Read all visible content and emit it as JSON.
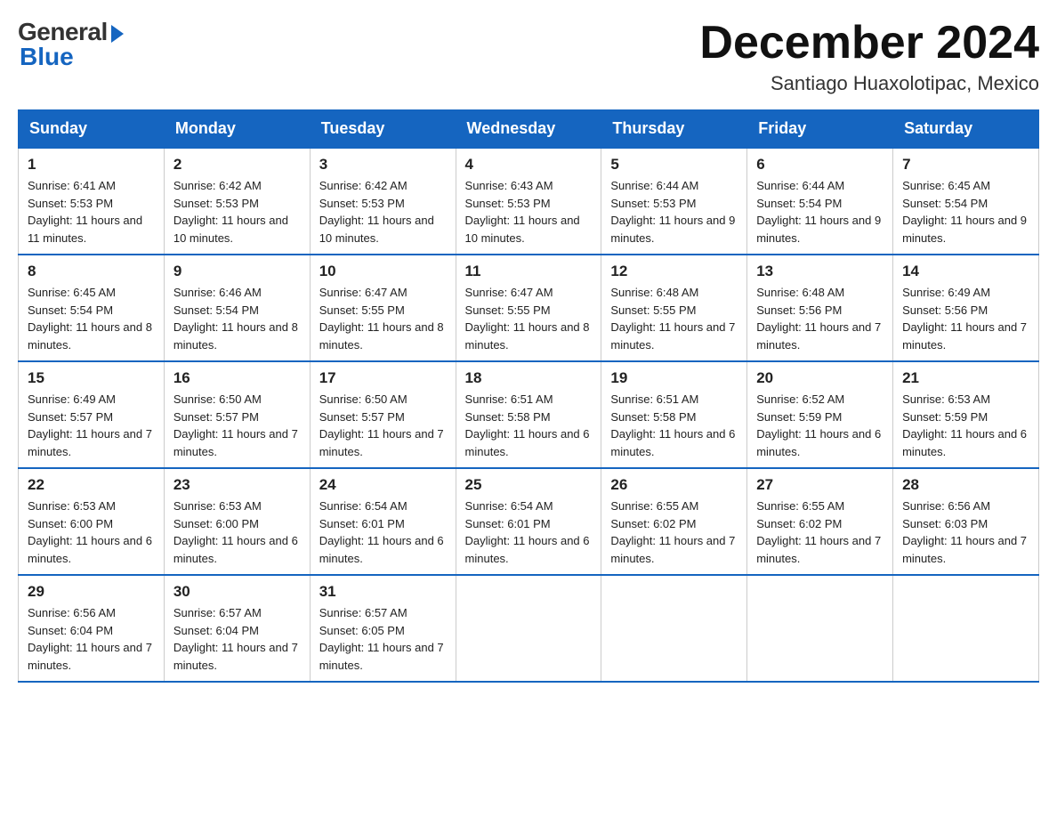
{
  "logo": {
    "general": "General",
    "blue": "Blue"
  },
  "header": {
    "month": "December 2024",
    "location": "Santiago Huaxolotipac, Mexico"
  },
  "days_of_week": [
    "Sunday",
    "Monday",
    "Tuesday",
    "Wednesday",
    "Thursday",
    "Friday",
    "Saturday"
  ],
  "weeks": [
    [
      {
        "day": "1",
        "sunrise": "6:41 AM",
        "sunset": "5:53 PM",
        "daylight": "11 hours and 11 minutes."
      },
      {
        "day": "2",
        "sunrise": "6:42 AM",
        "sunset": "5:53 PM",
        "daylight": "11 hours and 10 minutes."
      },
      {
        "day": "3",
        "sunrise": "6:42 AM",
        "sunset": "5:53 PM",
        "daylight": "11 hours and 10 minutes."
      },
      {
        "day": "4",
        "sunrise": "6:43 AM",
        "sunset": "5:53 PM",
        "daylight": "11 hours and 10 minutes."
      },
      {
        "day": "5",
        "sunrise": "6:44 AM",
        "sunset": "5:53 PM",
        "daylight": "11 hours and 9 minutes."
      },
      {
        "day": "6",
        "sunrise": "6:44 AM",
        "sunset": "5:54 PM",
        "daylight": "11 hours and 9 minutes."
      },
      {
        "day": "7",
        "sunrise": "6:45 AM",
        "sunset": "5:54 PM",
        "daylight": "11 hours and 9 minutes."
      }
    ],
    [
      {
        "day": "8",
        "sunrise": "6:45 AM",
        "sunset": "5:54 PM",
        "daylight": "11 hours and 8 minutes."
      },
      {
        "day": "9",
        "sunrise": "6:46 AM",
        "sunset": "5:54 PM",
        "daylight": "11 hours and 8 minutes."
      },
      {
        "day": "10",
        "sunrise": "6:47 AM",
        "sunset": "5:55 PM",
        "daylight": "11 hours and 8 minutes."
      },
      {
        "day": "11",
        "sunrise": "6:47 AM",
        "sunset": "5:55 PM",
        "daylight": "11 hours and 8 minutes."
      },
      {
        "day": "12",
        "sunrise": "6:48 AM",
        "sunset": "5:55 PM",
        "daylight": "11 hours and 7 minutes."
      },
      {
        "day": "13",
        "sunrise": "6:48 AM",
        "sunset": "5:56 PM",
        "daylight": "11 hours and 7 minutes."
      },
      {
        "day": "14",
        "sunrise": "6:49 AM",
        "sunset": "5:56 PM",
        "daylight": "11 hours and 7 minutes."
      }
    ],
    [
      {
        "day": "15",
        "sunrise": "6:49 AM",
        "sunset": "5:57 PM",
        "daylight": "11 hours and 7 minutes."
      },
      {
        "day": "16",
        "sunrise": "6:50 AM",
        "sunset": "5:57 PM",
        "daylight": "11 hours and 7 minutes."
      },
      {
        "day": "17",
        "sunrise": "6:50 AM",
        "sunset": "5:57 PM",
        "daylight": "11 hours and 7 minutes."
      },
      {
        "day": "18",
        "sunrise": "6:51 AM",
        "sunset": "5:58 PM",
        "daylight": "11 hours and 6 minutes."
      },
      {
        "day": "19",
        "sunrise": "6:51 AM",
        "sunset": "5:58 PM",
        "daylight": "11 hours and 6 minutes."
      },
      {
        "day": "20",
        "sunrise": "6:52 AM",
        "sunset": "5:59 PM",
        "daylight": "11 hours and 6 minutes."
      },
      {
        "day": "21",
        "sunrise": "6:53 AM",
        "sunset": "5:59 PM",
        "daylight": "11 hours and 6 minutes."
      }
    ],
    [
      {
        "day": "22",
        "sunrise": "6:53 AM",
        "sunset": "6:00 PM",
        "daylight": "11 hours and 6 minutes."
      },
      {
        "day": "23",
        "sunrise": "6:53 AM",
        "sunset": "6:00 PM",
        "daylight": "11 hours and 6 minutes."
      },
      {
        "day": "24",
        "sunrise": "6:54 AM",
        "sunset": "6:01 PM",
        "daylight": "11 hours and 6 minutes."
      },
      {
        "day": "25",
        "sunrise": "6:54 AM",
        "sunset": "6:01 PM",
        "daylight": "11 hours and 6 minutes."
      },
      {
        "day": "26",
        "sunrise": "6:55 AM",
        "sunset": "6:02 PM",
        "daylight": "11 hours and 7 minutes."
      },
      {
        "day": "27",
        "sunrise": "6:55 AM",
        "sunset": "6:02 PM",
        "daylight": "11 hours and 7 minutes."
      },
      {
        "day": "28",
        "sunrise": "6:56 AM",
        "sunset": "6:03 PM",
        "daylight": "11 hours and 7 minutes."
      }
    ],
    [
      {
        "day": "29",
        "sunrise": "6:56 AM",
        "sunset": "6:04 PM",
        "daylight": "11 hours and 7 minutes."
      },
      {
        "day": "30",
        "sunrise": "6:57 AM",
        "sunset": "6:04 PM",
        "daylight": "11 hours and 7 minutes."
      },
      {
        "day": "31",
        "sunrise": "6:57 AM",
        "sunset": "6:05 PM",
        "daylight": "11 hours and 7 minutes."
      },
      null,
      null,
      null,
      null
    ]
  ]
}
